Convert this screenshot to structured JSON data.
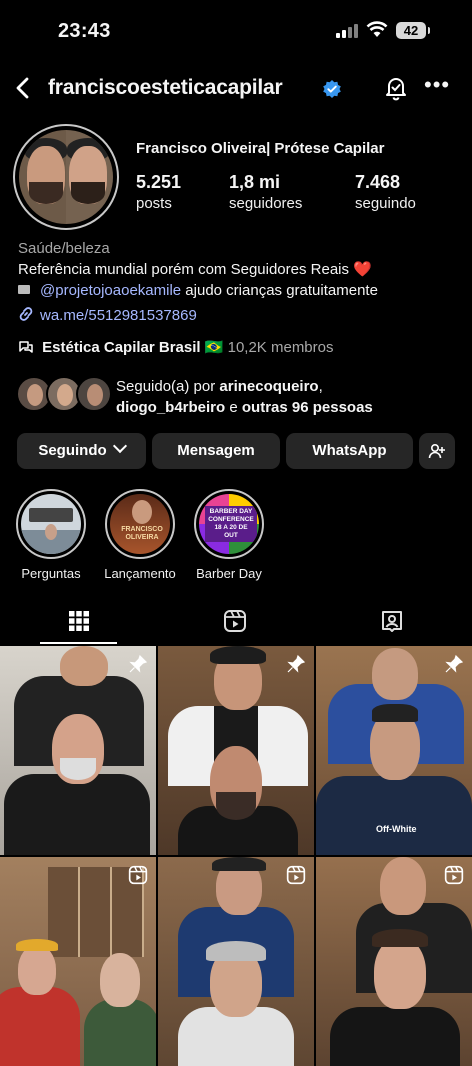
{
  "status_bar": {
    "time": "23:43",
    "battery": "42"
  },
  "profile": {
    "username": "franciscoesteticacapilar",
    "full_name": "Francisco Oliveira| Prótese Capilar",
    "stats": [
      {
        "value": "5.251",
        "label": "posts"
      },
      {
        "value": "1,8 mi",
        "label": "seguidores"
      },
      {
        "value": "7.468",
        "label": "seguindo"
      }
    ],
    "category": "Saúde/beleza",
    "bio_line1": "Referência mundial porém com Seguidores Reais ❤️",
    "bio_mention": "@projetojoaoekamile",
    "bio_line2_rest": " ajudo crianças gratuitamente",
    "link": "wa.me/5512981537869",
    "community_name": "Estética Capilar Brasil 🇧🇷",
    "community_members": "10,2K membros",
    "followed_prefix": "Seguido(a) por ",
    "followed_user1": "arinecoqueiro",
    "followed_sep": ",",
    "followed_user2": "diogo_b4rbeiro",
    "followed_mid": " e ",
    "followed_others": "outras 96 pessoas"
  },
  "buttons": {
    "following": "Seguindo",
    "message": "Mensagem",
    "whatsapp": "WhatsApp"
  },
  "highlights": [
    {
      "label": "Perguntas"
    },
    {
      "label": "Lançamento"
    },
    {
      "label": "Barber Day"
    }
  ],
  "highlight_text": {
    "lancamento": "FRANCISCO OLIVEIRA",
    "barber": "BARBER DAY CONFERENCE 18 A 20 DE OUT"
  },
  "grid": {
    "post_shirt_text": "Off-White"
  },
  "colors": {
    "background": "#000000",
    "button": "#262626",
    "link": "#a6b8ff",
    "verified": "#3897f0"
  }
}
